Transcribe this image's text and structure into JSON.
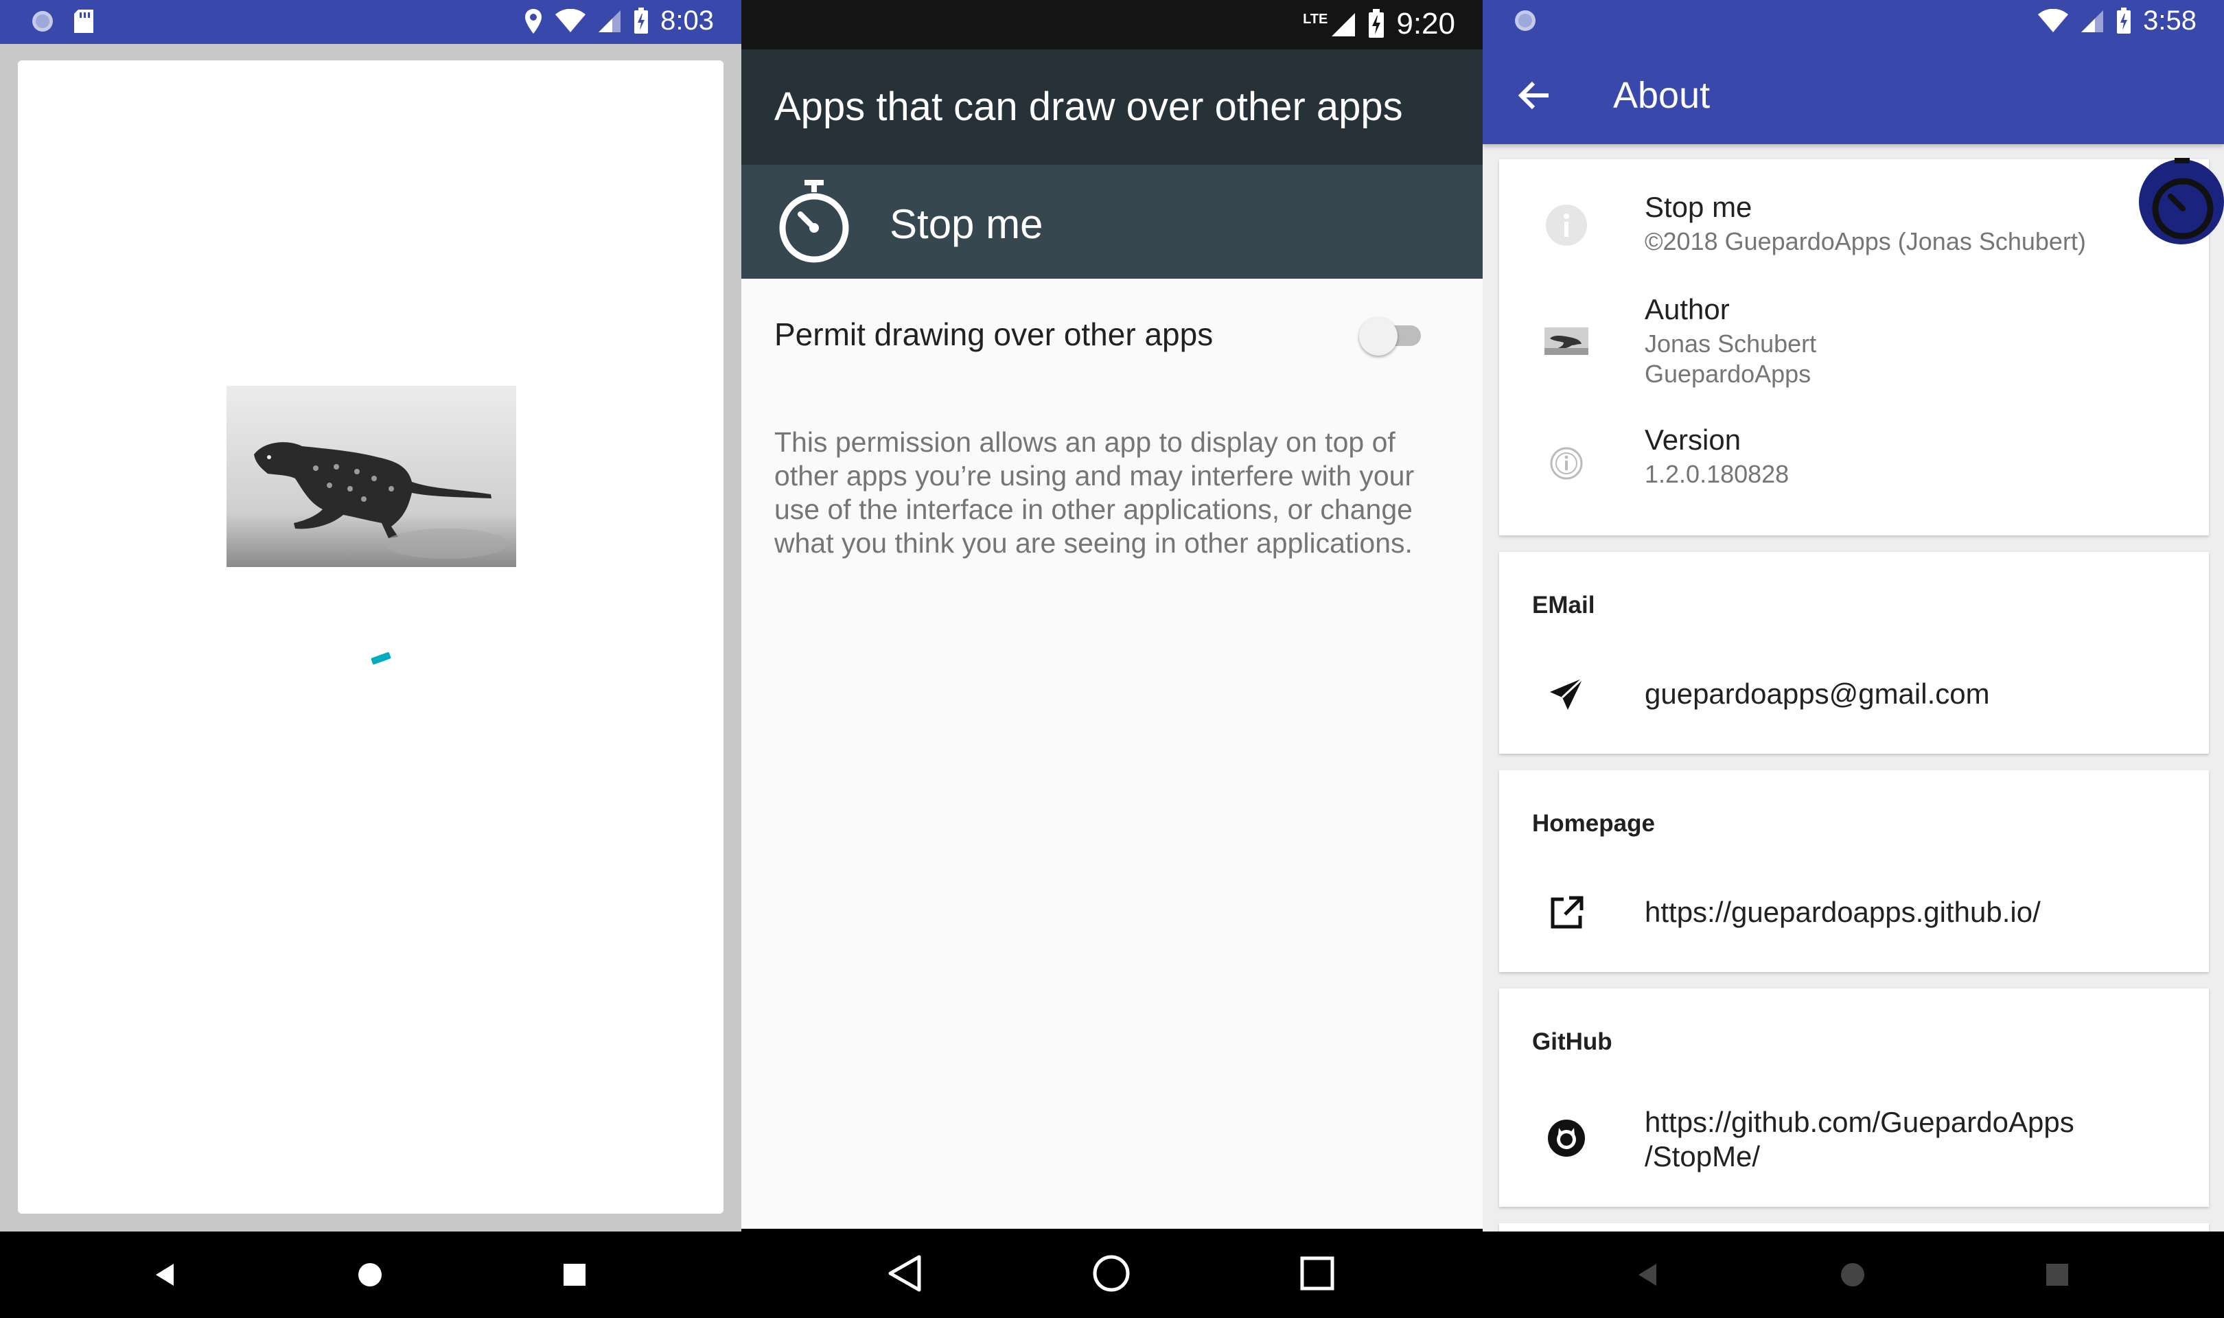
{
  "panel1": {
    "status": {
      "time": "8:03"
    }
  },
  "panel2": {
    "status": {
      "time": "9:20",
      "network": "LTE"
    },
    "title": "Apps that can draw over other apps",
    "app_name": "Stop me",
    "permission_label": "Permit drawing over other apps",
    "permission_enabled": false,
    "description": "This permission allows an app to display on top of other apps you’re using and may interfere with your use of the interface in other applications, or change what you think you are seeing in other applications."
  },
  "panel3": {
    "status": {
      "time": "3:58"
    },
    "title": "About",
    "app_info": {
      "name": "Stop me",
      "copyright": "©2018 GuepardoApps (Jonas Schubert)",
      "author_label": "Author",
      "author_name": "Jonas Schubert",
      "author_org": "GuepardoApps",
      "version_label": "Version",
      "version": "1.2.0.180828"
    },
    "email": {
      "header": "EMail",
      "value": "guepardoapps@gmail.com"
    },
    "homepage": {
      "header": "Homepage",
      "value": "https://guepardoapps.github.io/"
    },
    "github": {
      "header": "GitHub",
      "line1": "https://github.com/GuepardoApps",
      "line2": "/StopMe/"
    }
  },
  "colors": {
    "indigo": "#3949ab",
    "blue_grey_dark": "#263238",
    "blue_grey": "#37474f",
    "cyan_spinner": "#00acc1"
  },
  "icons": [
    "sd-card-icon",
    "location-icon",
    "wifi-icon",
    "signal-icon",
    "battery-charging-icon",
    "stopwatch-icon",
    "back-arrow-icon",
    "info-icon",
    "cheetah-avatar",
    "version-icon",
    "send-icon",
    "open-in-new-icon",
    "github-icon",
    "nav-back-icon",
    "nav-home-icon",
    "nav-recents-icon"
  ]
}
